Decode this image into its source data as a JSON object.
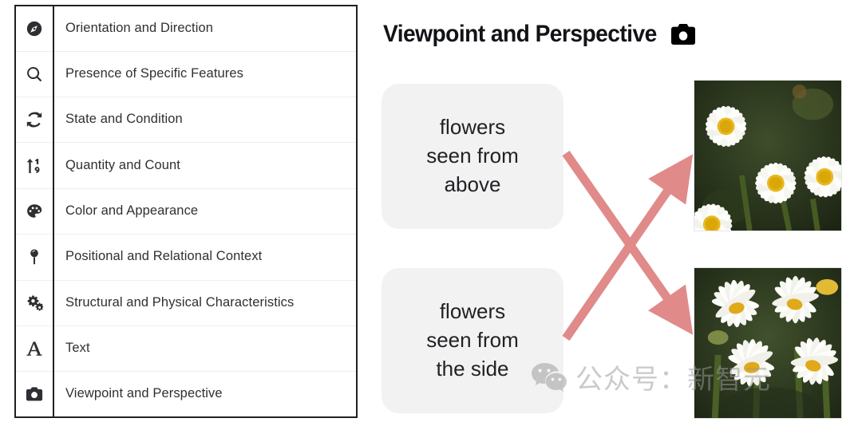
{
  "table": {
    "rows": [
      {
        "icon": "compass-icon",
        "label": "Orientation and Direction"
      },
      {
        "icon": "search-icon",
        "label": "Presence of Specific Features"
      },
      {
        "icon": "sync-icon",
        "label": "State and Condition"
      },
      {
        "icon": "sort-numeric-icon",
        "label": "Quantity and Count"
      },
      {
        "icon": "palette-icon",
        "label": "Color and Appearance"
      },
      {
        "icon": "map-pin-icon",
        "label": "Positional and Relational Context"
      },
      {
        "icon": "gears-icon",
        "label": "Structural and Physical Characteristics"
      },
      {
        "icon": "text-a-icon",
        "label": "Text"
      },
      {
        "icon": "camera-icon",
        "label": "Viewpoint and Perspective"
      }
    ]
  },
  "panel": {
    "title": "Viewpoint and Perspective",
    "title_icon": "camera-icon",
    "cards": [
      {
        "id": "above",
        "text": "flowers\nseen from\nabove"
      },
      {
        "id": "side",
        "text": "flowers\nseen from\nthe side"
      }
    ],
    "photos": [
      {
        "id": "above",
        "alt": "daisies photographed from above"
      },
      {
        "id": "side",
        "alt": "daisies photographed from the side"
      }
    ],
    "arrows": [
      {
        "from": "card-above",
        "to": "photo-side",
        "color": "#e08a8a"
      },
      {
        "from": "card-side",
        "to": "photo-above",
        "color": "#e08a8a"
      }
    ]
  },
  "watermark": {
    "logo": "wechat-icon",
    "text": "公众号：新智元"
  },
  "colors": {
    "arrow": "#e08a8a",
    "card_bg": "#f2f2f2",
    "table_border": "#1f2023",
    "row_divider": "#eceef0",
    "text": "#2f3033"
  }
}
